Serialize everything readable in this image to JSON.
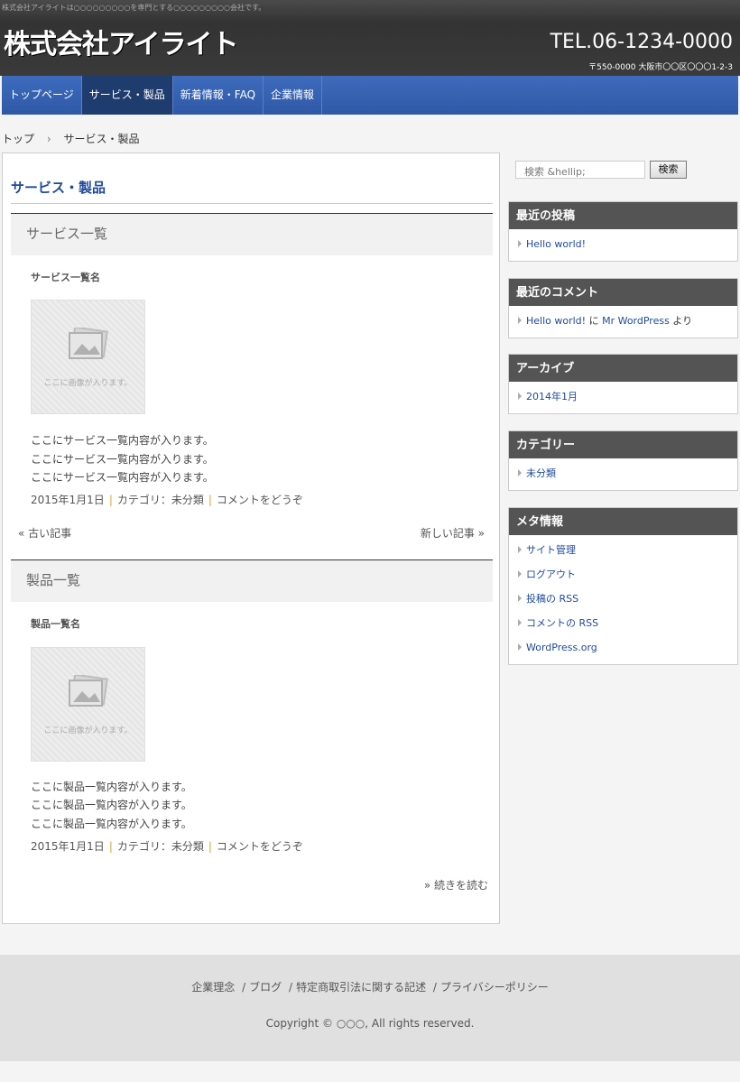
{
  "header": {
    "tagline": "株式会社アイライトは○○○○○○○○○を専門とする○○○○○○○○○会社です。",
    "logo": "株式会社アイライト",
    "tel": "TEL.06-1234-0000",
    "address": "〒550-0000 大阪市〇〇区〇〇〇1-2-3"
  },
  "nav": {
    "items": [
      "トップページ",
      "サービス・製品",
      "新着情報・FAQ",
      "企業情報"
    ],
    "active_index": 1
  },
  "breadcrumb": {
    "home": "トップ",
    "separator": "›",
    "current": "サービス・製品"
  },
  "main": {
    "page_title": "サービス・製品",
    "thumb_text": "ここに画像が入ります。",
    "posts": [
      {
        "heading": "サービス一覧",
        "item_name": "サービス一覧名",
        "lines": [
          "ここにサービス一覧内容が入ります。",
          "ここにサービス一覧内容が入ります。",
          "ここにサービス一覧内容が入ります。"
        ],
        "date": "2015年1月1日",
        "category": "カテゴリ：未分類",
        "comment": "コメントをどうぞ"
      },
      {
        "heading": "製品一覧",
        "item_name": "製品一覧名",
        "lines": [
          "ここに製品一覧内容が入ります。",
          "ここに製品一覧内容が入ります。",
          "ここに製品一覧内容が入ります。"
        ],
        "date": "2015年1月1日",
        "category": "カテゴリ：未分類",
        "comment": "コメントをどうぞ"
      }
    ],
    "pager": {
      "older": "« 古い記事",
      "newer": "新しい記事 »"
    },
    "read_more": "» 続きを読む"
  },
  "sidebar": {
    "search_placeholder": "検索 &hellip;",
    "search_button": "検索",
    "recent_posts": {
      "title": "最近の投稿",
      "items": [
        "Hello world!"
      ]
    },
    "recent_comments": {
      "title": "最近のコメント",
      "link1": "Hello world!",
      "mid": " に ",
      "link2": "Mr WordPress",
      "tail": " より"
    },
    "archives": {
      "title": "アーカイブ",
      "items": [
        "2014年1月"
      ]
    },
    "categories": {
      "title": "カテゴリー",
      "items": [
        "未分類"
      ]
    },
    "meta": {
      "title": "メタ情報",
      "items": [
        "サイト管理",
        "ログアウト",
        "投稿の RSS",
        "コメントの RSS",
        "WordPress.org"
      ]
    }
  },
  "footer": {
    "links": [
      "企業理念",
      "ブログ",
      "特定商取引法に関する記述",
      "プライバシーポリシー"
    ],
    "separator": "/",
    "copyright": "Copyright © ○○○, All rights reserved."
  },
  "colors": {
    "nav_bg": "#3e6bbd",
    "nav_active": "#1f3c6e",
    "link": "#1e4a9c",
    "widget_title_bg": "#545454"
  }
}
